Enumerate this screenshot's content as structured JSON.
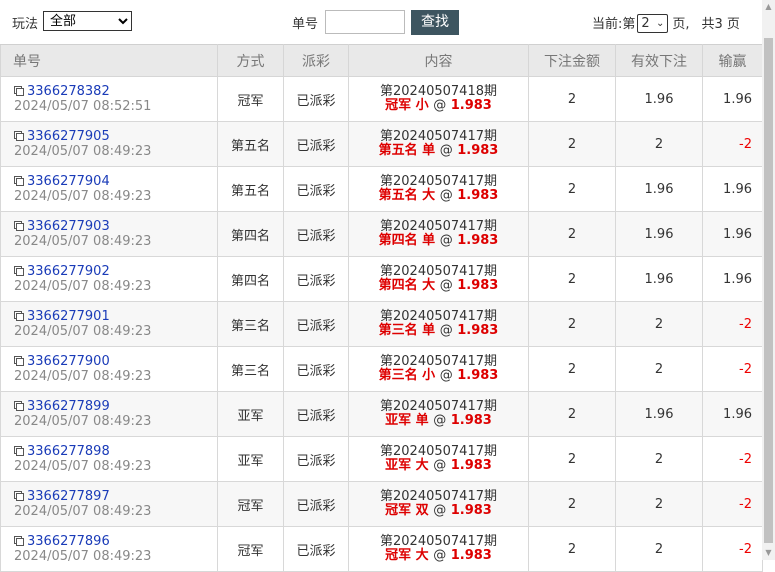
{
  "toolbar": {
    "play_label": "玩法",
    "play_value": "全部",
    "order_label": "单号",
    "order_value": "",
    "search_label": "查找",
    "pager_prefix": "当前:第",
    "page_value": "2",
    "pager_suffix": "页,",
    "total_text": "共3 页"
  },
  "table": {
    "headers": [
      "单号",
      "方式",
      "派彩",
      "内容",
      "下注金额",
      "有效下注",
      "输赢"
    ],
    "rows": [
      {
        "order": "3366278382",
        "time": "2024/05/07 08:52:51",
        "mode": "冠军",
        "status": "已派彩",
        "issue": "第20240507418期",
        "bet": "冠军 小",
        "odds": "1.983",
        "amount": "2",
        "valid": "1.96",
        "winloss": "1.96",
        "neg": false
      },
      {
        "order": "3366277905",
        "time": "2024/05/07 08:49:23",
        "mode": "第五名",
        "status": "已派彩",
        "issue": "第20240507417期",
        "bet": "第五名 单",
        "odds": "1.983",
        "amount": "2",
        "valid": "2",
        "winloss": "-2",
        "neg": true
      },
      {
        "order": "3366277904",
        "time": "2024/05/07 08:49:23",
        "mode": "第五名",
        "status": "已派彩",
        "issue": "第20240507417期",
        "bet": "第五名 大",
        "odds": "1.983",
        "amount": "2",
        "valid": "1.96",
        "winloss": "1.96",
        "neg": false
      },
      {
        "order": "3366277903",
        "time": "2024/05/07 08:49:23",
        "mode": "第四名",
        "status": "已派彩",
        "issue": "第20240507417期",
        "bet": "第四名 单",
        "odds": "1.983",
        "amount": "2",
        "valid": "1.96",
        "winloss": "1.96",
        "neg": false
      },
      {
        "order": "3366277902",
        "time": "2024/05/07 08:49:23",
        "mode": "第四名",
        "status": "已派彩",
        "issue": "第20240507417期",
        "bet": "第四名 大",
        "odds": "1.983",
        "amount": "2",
        "valid": "1.96",
        "winloss": "1.96",
        "neg": false
      },
      {
        "order": "3366277901",
        "time": "2024/05/07 08:49:23",
        "mode": "第三名",
        "status": "已派彩",
        "issue": "第20240507417期",
        "bet": "第三名 单",
        "odds": "1.983",
        "amount": "2",
        "valid": "2",
        "winloss": "-2",
        "neg": true
      },
      {
        "order": "3366277900",
        "time": "2024/05/07 08:49:23",
        "mode": "第三名",
        "status": "已派彩",
        "issue": "第20240507417期",
        "bet": "第三名 小",
        "odds": "1.983",
        "amount": "2",
        "valid": "2",
        "winloss": "-2",
        "neg": true
      },
      {
        "order": "3366277899",
        "time": "2024/05/07 08:49:23",
        "mode": "亚军",
        "status": "已派彩",
        "issue": "第20240507417期",
        "bet": "亚军 单",
        "odds": "1.983",
        "amount": "2",
        "valid": "1.96",
        "winloss": "1.96",
        "neg": false
      },
      {
        "order": "3366277898",
        "time": "2024/05/07 08:49:23",
        "mode": "亚军",
        "status": "已派彩",
        "issue": "第20240507417期",
        "bet": "亚军 大",
        "odds": "1.983",
        "amount": "2",
        "valid": "2",
        "winloss": "-2",
        "neg": true
      },
      {
        "order": "3366277897",
        "time": "2024/05/07 08:49:23",
        "mode": "冠军",
        "status": "已派彩",
        "issue": "第20240507417期",
        "bet": "冠军 双",
        "odds": "1.983",
        "amount": "2",
        "valid": "2",
        "winloss": "-2",
        "neg": true
      },
      {
        "order": "3366277896",
        "time": "2024/05/07 08:49:23",
        "mode": "冠军",
        "status": "已派彩",
        "issue": "第20240507417期",
        "bet": "冠军 大",
        "odds": "1.983",
        "amount": "2",
        "valid": "2",
        "winloss": "-2",
        "neg": true
      }
    ]
  },
  "colors": {
    "header_bg": "#e9e9e9",
    "link": "#1a3bb8",
    "bet_red": "#dd0000",
    "search_btn": "#3d5560"
  }
}
